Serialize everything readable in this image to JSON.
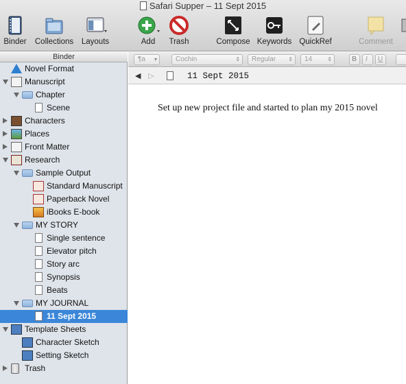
{
  "window": {
    "title": "Safari Supper – 11 Sept 2015"
  },
  "toolbar": {
    "items": [
      {
        "label": "Binder",
        "icon": "binder-icon"
      },
      {
        "label": "Collections",
        "icon": "collections-icon"
      },
      {
        "label": "Layouts",
        "icon": "layouts-icon"
      },
      {
        "label": "Add",
        "icon": "add-icon"
      },
      {
        "label": "Trash",
        "icon": "trash-icon"
      },
      {
        "label": "Compose",
        "icon": "compose-icon"
      },
      {
        "label": "Keywords",
        "icon": "keywords-icon"
      },
      {
        "label": "QuickRef",
        "icon": "quickref-icon"
      },
      {
        "label": "Comment",
        "icon": "comment-icon"
      }
    ]
  },
  "formatbar": {
    "paragraph_style": "¶a",
    "font_family": "Cochin",
    "font_style": "Regular",
    "font_size": "14",
    "bold": "B",
    "italic": "I",
    "underline": "U"
  },
  "binder": {
    "header": "Binder",
    "items": [
      {
        "label": "Novel Format",
        "icon": "info-icon",
        "level": 0,
        "expand": ""
      },
      {
        "label": "Manuscript",
        "icon": "manuscript-icon",
        "level": 0,
        "expand": "down"
      },
      {
        "label": "Chapter",
        "icon": "folder-icon",
        "level": 1,
        "expand": "down"
      },
      {
        "label": "Scene",
        "icon": "document-icon",
        "level": 2,
        "expand": ""
      },
      {
        "label": "Characters",
        "icon": "characters-icon",
        "level": 0,
        "expand": "right"
      },
      {
        "label": "Places",
        "icon": "places-icon",
        "level": 0,
        "expand": "right"
      },
      {
        "label": "Front Matter",
        "icon": "front-matter-icon",
        "level": 0,
        "expand": "right"
      },
      {
        "label": "Research",
        "icon": "research-icon",
        "level": 0,
        "expand": "down"
      },
      {
        "label": "Sample Output",
        "icon": "folder-icon",
        "level": 1,
        "expand": "down"
      },
      {
        "label": "Standard Manuscript",
        "icon": "pdf-icon",
        "level": 2,
        "expand": ""
      },
      {
        "label": "Paperback Novel",
        "icon": "pdf-icon",
        "level": 2,
        "expand": ""
      },
      {
        "label": "iBooks E-book",
        "icon": "ibooks-icon",
        "level": 2,
        "expand": ""
      },
      {
        "label": "MY STORY",
        "icon": "folder-icon",
        "level": 1,
        "expand": "down"
      },
      {
        "label": "Single sentence",
        "icon": "document-icon",
        "level": 2,
        "expand": ""
      },
      {
        "label": "Elevator pitch",
        "icon": "document-icon",
        "level": 2,
        "expand": ""
      },
      {
        "label": "Story arc",
        "icon": "document-icon",
        "level": 2,
        "expand": ""
      },
      {
        "label": "Synopsis",
        "icon": "document-icon",
        "level": 2,
        "expand": ""
      },
      {
        "label": "Beats",
        "icon": "document-icon",
        "level": 2,
        "expand": ""
      },
      {
        "label": "MY JOURNAL",
        "icon": "folder-icon",
        "level": 1,
        "expand": "down"
      },
      {
        "label": "11 Sept 2015",
        "icon": "document-icon",
        "level": 2,
        "expand": "",
        "selected": true
      },
      {
        "label": "Template Sheets",
        "icon": "template-icon",
        "level": 0,
        "expand": "down"
      },
      {
        "label": "Character Sketch",
        "icon": "character-sketch-icon",
        "level": 1,
        "expand": ""
      },
      {
        "label": "Setting Sketch",
        "icon": "setting-sketch-icon",
        "level": 1,
        "expand": ""
      },
      {
        "label": "Trash",
        "icon": "trash-bin-icon",
        "level": 0,
        "expand": "right"
      }
    ]
  },
  "navigation": {
    "document_title": "11 Sept 2015"
  },
  "editor": {
    "text": "Set up new project file and started to plan my 2015 novel"
  },
  "colors": {
    "selection": "#3b86d8",
    "binder_bg": "#dfe4ea"
  }
}
